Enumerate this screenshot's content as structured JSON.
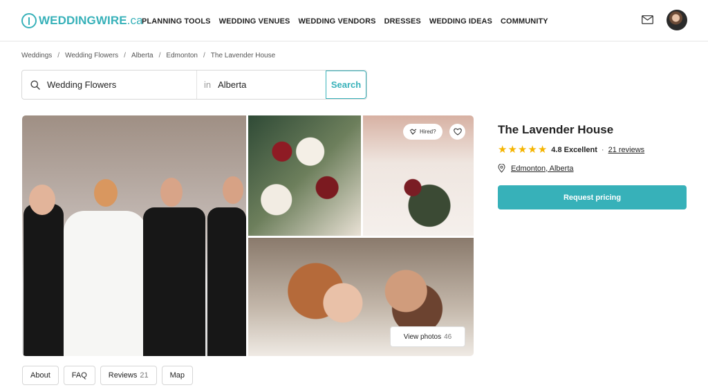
{
  "header": {
    "logo_main": "WEDDINGWIRE",
    "logo_suffix": ".ca",
    "nav": [
      "PLANNING TOOLS",
      "WEDDING VENUES",
      "WEDDING VENDORS",
      "DRESSES",
      "WEDDING IDEAS",
      "COMMUNITY"
    ],
    "icons": [
      "mail-icon",
      "user-avatar"
    ]
  },
  "breadcrumb": [
    "Weddings",
    "Wedding Flowers",
    "Alberta",
    "Edmonton",
    "The Lavender House"
  ],
  "search": {
    "what_value": "Wedding Flowers",
    "in_label": "in",
    "where_value": "Alberta",
    "button_label": "Search"
  },
  "gallery": {
    "hired_label": "Hired?",
    "view_photos_label": "View photos",
    "photo_count": "46"
  },
  "vendor": {
    "name": "The Lavender House",
    "rating": "4.8 Excellent",
    "stars": 5,
    "separator": "·",
    "reviews_link": "21 reviews",
    "location": "Edmonton, Alberta",
    "request_button": "Request pricing"
  },
  "tabs": [
    {
      "label": "About",
      "badge": ""
    },
    {
      "label": "FAQ",
      "badge": ""
    },
    {
      "label": "Reviews",
      "badge": "21"
    },
    {
      "label": "Map",
      "badge": ""
    }
  ],
  "colors": {
    "brand": "#37b1b9",
    "star": "#f5b400"
  }
}
